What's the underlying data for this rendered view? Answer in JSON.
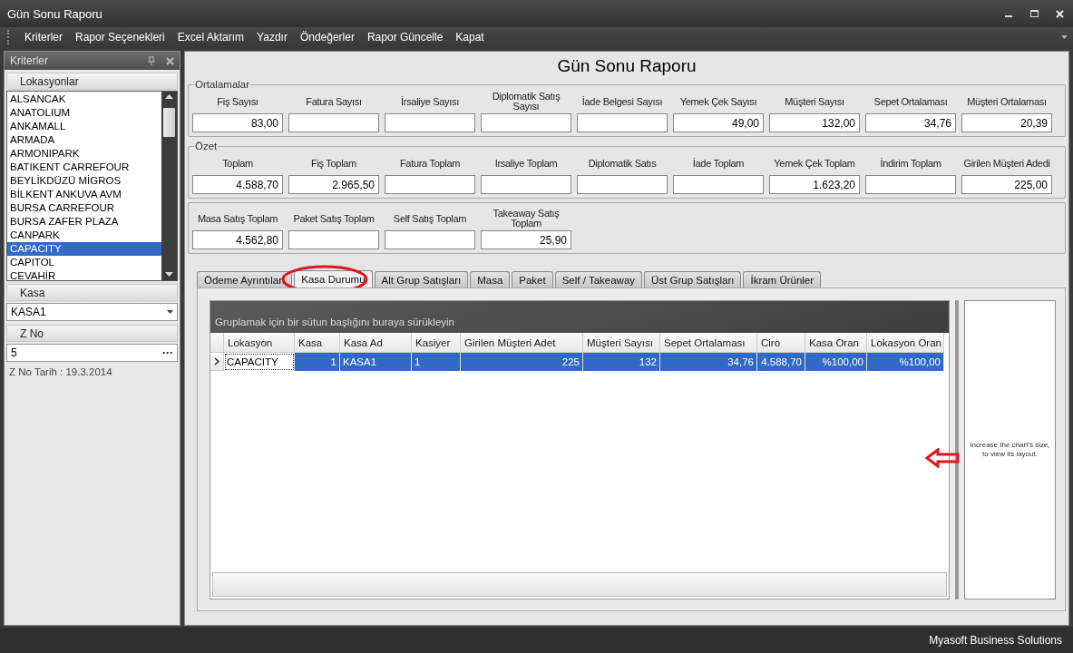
{
  "window": {
    "title": "Gün Sonu Raporu"
  },
  "menu": [
    "Kriterler",
    "Rapor Seçenekleri",
    "Excel Aktarım",
    "Yazdır",
    "Öndeğerler",
    "Rapor Güncelle",
    "Kapat"
  ],
  "criteria_panel": {
    "title": "Kriterler",
    "locations": {
      "label": "Lokasyonlar",
      "items": [
        {
          "label": "ALSANCAK",
          "selected": false
        },
        {
          "label": "ANATOLIUM",
          "selected": false
        },
        {
          "label": "ANKAMALL",
          "selected": false
        },
        {
          "label": "ARMADA",
          "selected": false
        },
        {
          "label": "ARMONIPARK",
          "selected": false
        },
        {
          "label": "BATIKENT CARREFOUR",
          "selected": false
        },
        {
          "label": "BEYLİKDÜZÜ MİGROS",
          "selected": false
        },
        {
          "label": "BİLKENT ANKUVA AVM",
          "selected": false
        },
        {
          "label": "BURSA CARREFOUR",
          "selected": false
        },
        {
          "label": "BURSA ZAFER PLAZA",
          "selected": false
        },
        {
          "label": "CANPARK",
          "selected": false
        },
        {
          "label": "CAPACITY",
          "selected": true
        },
        {
          "label": "CAPITOL",
          "selected": false
        },
        {
          "label": "CEVAHİR",
          "selected": false
        }
      ]
    },
    "kasa": {
      "label": "Kasa",
      "value": "KASA1"
    },
    "z_no": {
      "label": "Z No",
      "value": "5",
      "button": "···"
    },
    "z_no_date": "Z No Tarih : 19.3.2014"
  },
  "report_title": "Gün Sonu Raporu",
  "groups": [
    {
      "title": "Ortalamalar",
      "fields": [
        {
          "label": "Fiş Sayısı",
          "value": "83,00"
        },
        {
          "label": "Fatura Sayısı"
        },
        {
          "label": "İrsaliye Sayısı"
        },
        {
          "label": "Diplomatik Satış Sayısı"
        },
        {
          "label": "İade Belgesi Sayısı"
        },
        {
          "label": "Yemek Çek Sayısı",
          "value": "49,00"
        },
        {
          "label": "Müşteri Sayısı",
          "value": "132,00"
        },
        {
          "label": "Sepet Ortalaması",
          "value": "34,76"
        },
        {
          "label": "Müşteri Ortalaması",
          "value": "20,39"
        }
      ]
    },
    {
      "title": "Özet",
      "fields": [
        {
          "label": "Toplam",
          "value": "4.588,70"
        },
        {
          "label": "Fiş Toplam",
          "value": "2.965,50"
        },
        {
          "label": "Fatura Toplam"
        },
        {
          "label": "Irsaliye Toplam"
        },
        {
          "label": "Diplomatik Satıs"
        },
        {
          "label": "İade Toplam"
        },
        {
          "label": "Yemek Çek Toplam",
          "value": "1.623,20"
        },
        {
          "label": "İndirim Toplam"
        },
        {
          "label": "Girilen Müşteri Adedi",
          "value": "225,00"
        }
      ]
    },
    {
      "fields": [
        {
          "label": "Masa Satış Toplam",
          "value": "4.562,80"
        },
        {
          "label": "Paket Satış Toplam"
        },
        {
          "label": "Self Satış Toplam"
        },
        {
          "label": "Takeaway Satış Toplam",
          "value": "25,90"
        }
      ]
    }
  ],
  "tabs": [
    {
      "label": "Ödeme Ayrıntıları",
      "selected": false
    },
    {
      "label": "Kasa Durumu",
      "selected": true
    },
    {
      "label": "Alt Grup Satışları",
      "selected": false
    },
    {
      "label": "Masa",
      "selected": false
    },
    {
      "label": "Paket",
      "selected": false
    },
    {
      "label": "Self / Takeaway",
      "selected": false
    },
    {
      "label": "Üst Grup Satışları",
      "selected": false
    },
    {
      "label": "İkram Ürünler",
      "selected": false
    }
  ],
  "grid": {
    "group_hint": "Gruplamak için bir sütun başlığını buraya sürükleyin",
    "columns": [
      {
        "label": "Lokasyon",
        "kind": "text"
      },
      {
        "label": "Kasa",
        "kind": "number"
      },
      {
        "label": "Kasa Ad",
        "kind": "text"
      },
      {
        "label": "Kasiyer",
        "kind": "text"
      },
      {
        "label": "Girilen Müşteri Adet",
        "kind": "number"
      },
      {
        "label": "Müşteri Sayısı",
        "kind": "number"
      },
      {
        "label": "Sepet Ortalaması",
        "kind": "number"
      },
      {
        "label": "Ciro",
        "kind": "number"
      },
      {
        "label": "Kasa Oran",
        "kind": "number"
      },
      {
        "label": "Lokasyon Oran",
        "kind": "number"
      }
    ],
    "rows": [
      {
        "selected": true,
        "cells": [
          "CAPACITY",
          "1",
          "KASA1",
          "1",
          "225",
          "132",
          "34,76",
          "4.588,70",
          "%100,00",
          "%100,00"
        ]
      }
    ]
  },
  "chart_pane": {
    "message": "Increase the chart's size, to view its layout."
  },
  "status_bar": "Myasoft Business Solutions"
}
